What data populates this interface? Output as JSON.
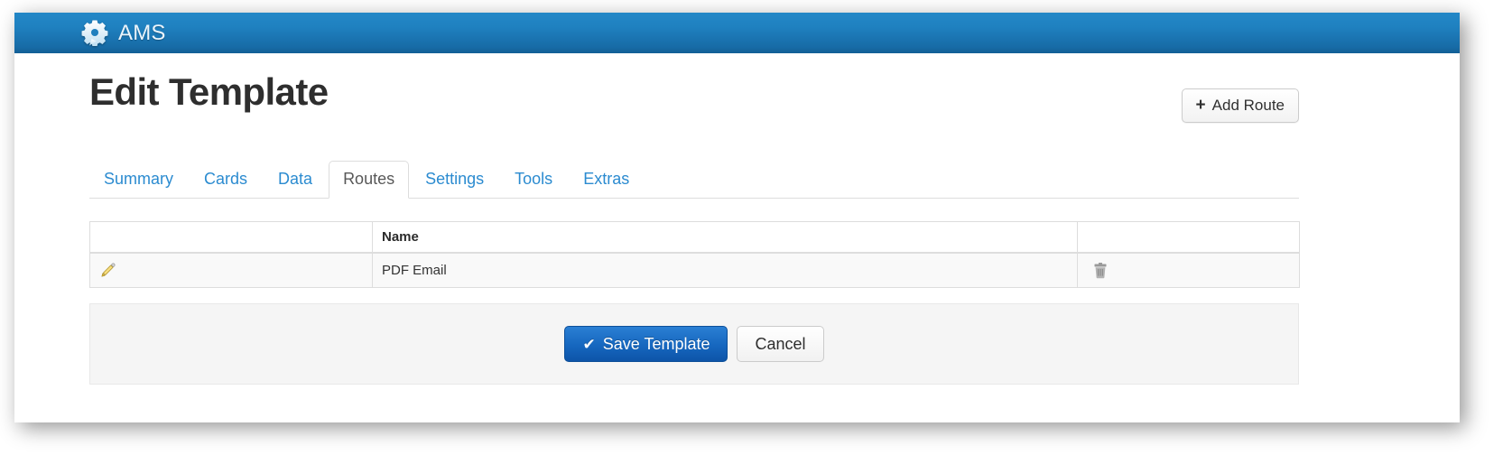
{
  "navbar": {
    "brand_label": "AMS",
    "brand_icon": "gear-icon",
    "background_color": "#1f81c0"
  },
  "page": {
    "title": "Edit Template",
    "add_route_button": {
      "label": "Add Route",
      "plus_glyph": "+"
    }
  },
  "tabs": {
    "items": [
      {
        "label": "Summary",
        "active": false
      },
      {
        "label": "Cards",
        "active": false
      },
      {
        "label": "Data",
        "active": false
      },
      {
        "label": "Routes",
        "active": true
      },
      {
        "label": "Settings",
        "active": false
      },
      {
        "label": "Tools",
        "active": false
      },
      {
        "label": "Extras",
        "active": false
      }
    ],
    "active_index": 3,
    "link_color": "#2b8bd0",
    "active_color": "#585858"
  },
  "routes_table": {
    "columns": [
      "",
      "Name",
      ""
    ],
    "rows": [
      {
        "edit_icon": "pencil-icon",
        "name": "PDF Email",
        "delete_icon": "trash-icon"
      }
    ]
  },
  "footer": {
    "save_button": {
      "label": "Save Template",
      "check_glyph": "✔",
      "color": "#1667bf"
    },
    "cancel_button": {
      "label": "Cancel"
    }
  }
}
